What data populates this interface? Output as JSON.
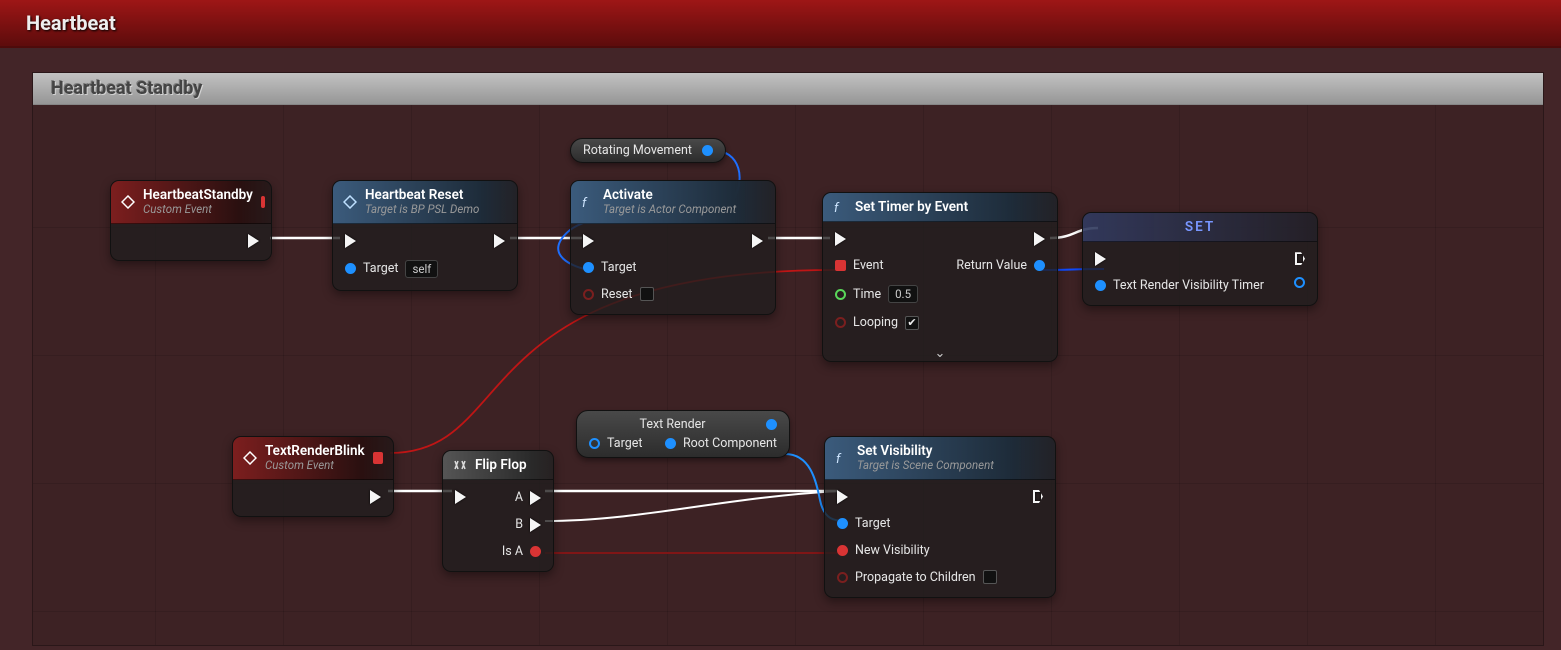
{
  "header": {
    "title": "Heartbeat"
  },
  "comment": {
    "title": "Heartbeat Standby"
  },
  "nodes": {
    "heartbeatStandby": {
      "title": "HeartbeatStandby",
      "subtitle": "Custom Event"
    },
    "heartbeatReset": {
      "title": "Heartbeat Reset",
      "subtitle": "Target is BP PSL Demo",
      "pins": {
        "target": "Target",
        "targetValue": "self"
      }
    },
    "activate": {
      "title": "Activate",
      "subtitle": "Target is Actor Component",
      "pins": {
        "target": "Target",
        "reset": "Reset"
      }
    },
    "setTimer": {
      "title": "Set Timer by Event",
      "pins": {
        "event": "Event",
        "time": "Time",
        "timeValue": "0.5",
        "looping": "Looping",
        "returnValue": "Return Value"
      }
    },
    "set": {
      "title": "SET",
      "pins": {
        "var": "Text Render Visibility Timer"
      }
    },
    "textRenderBlink": {
      "title": "TextRenderBlink",
      "subtitle": "Custom Event"
    },
    "flipFlop": {
      "title": "Flip Flop",
      "pins": {
        "a": "A",
        "b": "B",
        "isA": "Is A"
      }
    },
    "setVisibility": {
      "title": "Set Visibility",
      "subtitle": "Target is Scene Component",
      "pins": {
        "target": "Target",
        "newVis": "New Visibility",
        "propagate": "Propagate to Children"
      }
    }
  },
  "vars": {
    "rotatingMovement": {
      "label": "Rotating Movement"
    },
    "textRender": {
      "label": "Text Render",
      "pins": {
        "target": "Target",
        "root": "Root Component"
      }
    }
  },
  "colors": {
    "exec": "#f5f5f5",
    "object": "#1e90ff",
    "float": "#59d75a",
    "bool": "#d93434",
    "delegate": "#d93434",
    "struct": "#4fc9e6"
  }
}
